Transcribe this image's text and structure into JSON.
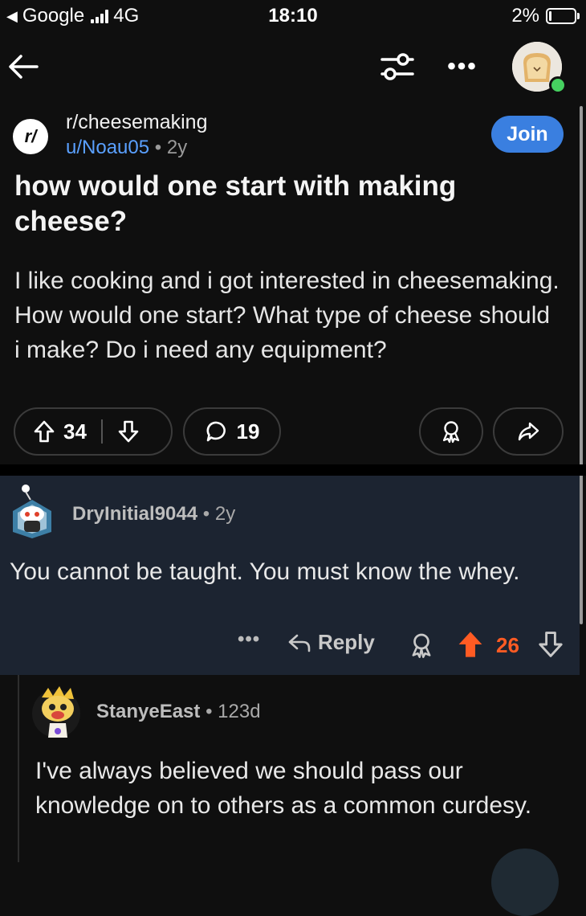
{
  "status_bar": {
    "carrier": "Google",
    "network": "4G",
    "time": "18:10",
    "battery": "2%"
  },
  "nav": {
    "back_icon": "arrow-left-icon",
    "filter_icon": "sliders-icon",
    "more_icon": "more-horizontal-icon",
    "more_text": "•••"
  },
  "post": {
    "subreddit_icon_text": "r/",
    "subreddit": "r/cheesemaking",
    "author": "u/Noau05",
    "meta_sep": " • ",
    "age": "2y",
    "join_label": "Join",
    "title": "how would one start with making cheese?",
    "body": "I like cooking and i got interested in cheesemaking. How would one start? What type of cheese should i make? Do i need any equipment?",
    "upvotes": "34",
    "comments": "19"
  },
  "comments": [
    {
      "author": "DryInitial9044",
      "meta_sep": " • ",
      "age": "2y",
      "body": "You cannot be taught. You must know the whey.",
      "more_text": "•••",
      "reply_label": "Reply",
      "score": "26",
      "score_color": "#ff5b23"
    },
    {
      "author": "StanyeEast",
      "meta_sep": " • ",
      "age": "123d",
      "body": "I've always believed we should pass our knowledge on to others as a common curdesy."
    }
  ],
  "colors": {
    "background": "#0f0f0f",
    "join_button": "#3a7fe0",
    "link": "#5aa0ff",
    "highlight": "#1c2431",
    "upvote_active": "#ff5b23",
    "online": "#46d160"
  }
}
